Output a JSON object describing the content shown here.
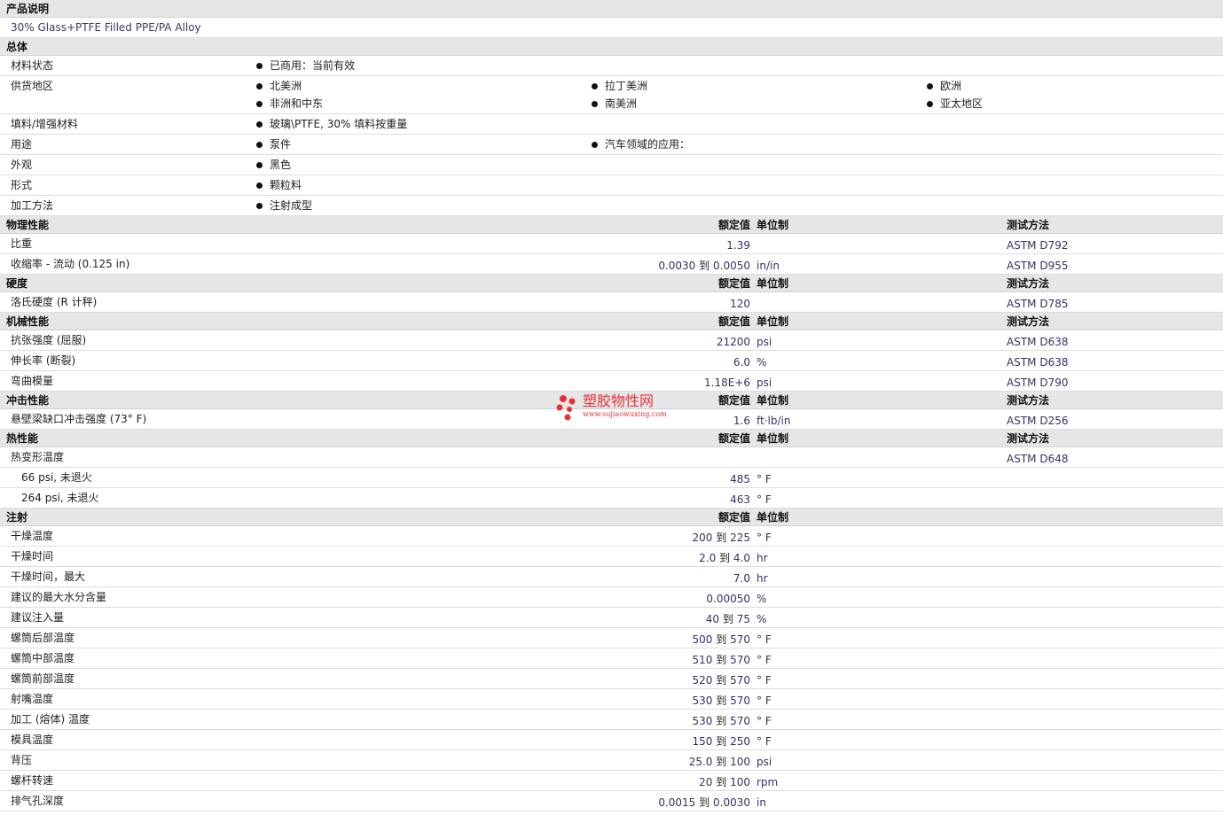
{
  "colors": {
    "section_bg": "#e6e6e6",
    "row_divider": "#dddddd",
    "value_text": "#333366",
    "watermark": "#e8323a"
  },
  "product": {
    "title": "产品说明",
    "description": "30% Glass+PTFE Filled PPE/PA Alloy"
  },
  "general": {
    "title": "总体",
    "material_status": {
      "label": "材料状态",
      "values": [
        "已商用：当前有效"
      ]
    },
    "supply_region": {
      "label": "供货地区",
      "values": [
        "北美洲",
        "拉丁美洲",
        "欧洲",
        "非洲和中东",
        "南美洲",
        "亚太地区"
      ]
    },
    "filler": {
      "label": "填料/增强材料",
      "values": [
        "玻璃\\PTFE, 30% 填料按重量"
      ]
    },
    "uses": {
      "label": "用途",
      "values": [
        "泵件",
        "汽车领域的应用："
      ]
    },
    "appearance": {
      "label": "外观",
      "values": [
        "黑色"
      ]
    },
    "form": {
      "label": "形式",
      "values": [
        "颗粒料"
      ]
    },
    "processing": {
      "label": "加工方法",
      "values": [
        "注射成型"
      ]
    }
  },
  "columns": {
    "nominal": "额定值",
    "unit": "单位制",
    "test": "测试方法"
  },
  "physical": {
    "title": "物理性能",
    "rows": [
      {
        "label": "比重",
        "v1": "1.39",
        "to": "",
        "v2": "",
        "unit": "",
        "test": "ASTM D792"
      },
      {
        "label": "收缩率 - 流动 (0.125 in)",
        "v1": "0.0030",
        "to": "到",
        "v2": "0.0050",
        "unit": "in/in",
        "test": "ASTM D955"
      }
    ]
  },
  "hardness": {
    "title": "硬度",
    "rows": [
      {
        "label": "洛氏硬度 (R 计秤)",
        "v1": "120",
        "to": "",
        "v2": "",
        "unit": "",
        "test": "ASTM D785"
      }
    ]
  },
  "mechanical": {
    "title": "机械性能",
    "rows": [
      {
        "label": "抗张强度 (屈服)",
        "v1": "21200",
        "to": "",
        "v2": "",
        "unit": "psi",
        "test": "ASTM D638"
      },
      {
        "label": "伸长率 (断裂)",
        "v1": "6.0",
        "to": "",
        "v2": "",
        "unit": "%",
        "test": "ASTM D638"
      },
      {
        "label": "弯曲模量",
        "v1": "1.18E+6",
        "to": "",
        "v2": "",
        "unit": "psi",
        "test": "ASTM D790"
      }
    ]
  },
  "impact": {
    "title": "冲击性能",
    "rows": [
      {
        "label": "悬壁梁缺口冲击强度 (73° F)",
        "v1": "1.6",
        "to": "",
        "v2": "",
        "unit": "ft·lb/in",
        "test": "ASTM D256"
      }
    ]
  },
  "thermal": {
    "title": "热性能",
    "rows": [
      {
        "label": "热变形温度",
        "v1": "",
        "to": "",
        "v2": "",
        "unit": "",
        "test": "ASTM D648"
      },
      {
        "label": "66 psi, 未退火",
        "v1": "485",
        "to": "",
        "v2": "",
        "unit": "° F",
        "test": ""
      },
      {
        "label": "264 psi, 未退火",
        "v1": "463",
        "to": "",
        "v2": "",
        "unit": "° F",
        "test": ""
      }
    ]
  },
  "injection": {
    "title": "注射",
    "rows": [
      {
        "label": "干燥温度",
        "v1": "200",
        "to": "到",
        "v2": "225",
        "unit": "° F"
      },
      {
        "label": "干燥时间",
        "v1": "2.0",
        "to": "到",
        "v2": "4.0",
        "unit": "hr"
      },
      {
        "label": "干燥时间，最大",
        "v1": "7.0",
        "to": "",
        "v2": "",
        "unit": "hr"
      },
      {
        "label": "建议的最大水分含量",
        "v1": "0.00050",
        "to": "",
        "v2": "",
        "unit": "%"
      },
      {
        "label": "建议注入量",
        "v1": "40",
        "to": "到",
        "v2": "75",
        "unit": "%"
      },
      {
        "label": "螺筒后部温度",
        "v1": "500",
        "to": "到",
        "v2": "570",
        "unit": "° F"
      },
      {
        "label": "螺筒中部温度",
        "v1": "510",
        "to": "到",
        "v2": "570",
        "unit": "° F"
      },
      {
        "label": "螺筒前部温度",
        "v1": "520",
        "to": "到",
        "v2": "570",
        "unit": "° F"
      },
      {
        "label": "射嘴温度",
        "v1": "530",
        "to": "到",
        "v2": "570",
        "unit": "° F"
      },
      {
        "label": "加工 (熔体) 温度",
        "v1": "530",
        "to": "到",
        "v2": "570",
        "unit": "° F"
      },
      {
        "label": "模具温度",
        "v1": "150",
        "to": "到",
        "v2": "250",
        "unit": "° F"
      },
      {
        "label": "背压",
        "v1": "25.0",
        "to": "到",
        "v2": "100",
        "unit": "psi"
      },
      {
        "label": "螺杆转速",
        "v1": "20",
        "to": "到",
        "v2": "100",
        "unit": "rpm"
      },
      {
        "label": "排气孔深度",
        "v1": "0.0015",
        "to": "到",
        "v2": "0.0030",
        "unit": "in"
      }
    ]
  },
  "watermark": {
    "text": "塑胶物性网",
    "url": "www.sujiaowuxing.com"
  }
}
